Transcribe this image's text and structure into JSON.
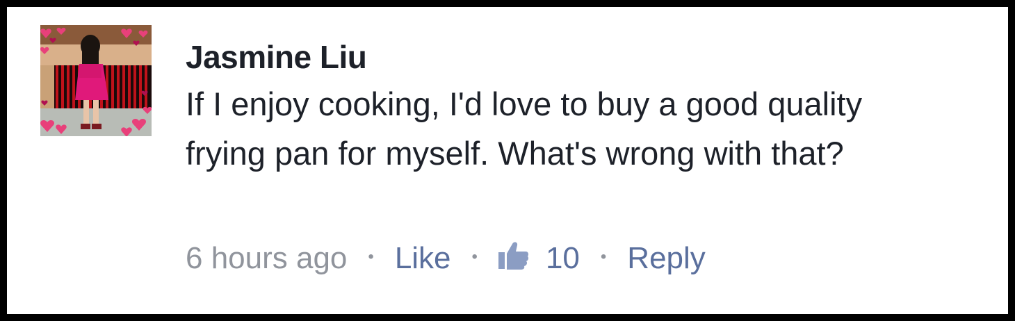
{
  "comment": {
    "author": "Jasmine Liu",
    "text": "If I enjoy cooking, I'd love to buy a good quality frying pan for myself. What's wrong with that?",
    "avatar_icon": "profile-photo-girl-pink-dress-hearts-frame",
    "time": "6 hours ago",
    "separator": "•",
    "like_label": "Like",
    "like_icon": "thumbs-up-icon",
    "like_count": "10",
    "reply_label": "Reply"
  },
  "colors": {
    "author_text": "#1d2129",
    "meta_gray": "#90949c",
    "link_blue": "#5a6f9d",
    "thumb_blue": "#8b9dc3"
  }
}
